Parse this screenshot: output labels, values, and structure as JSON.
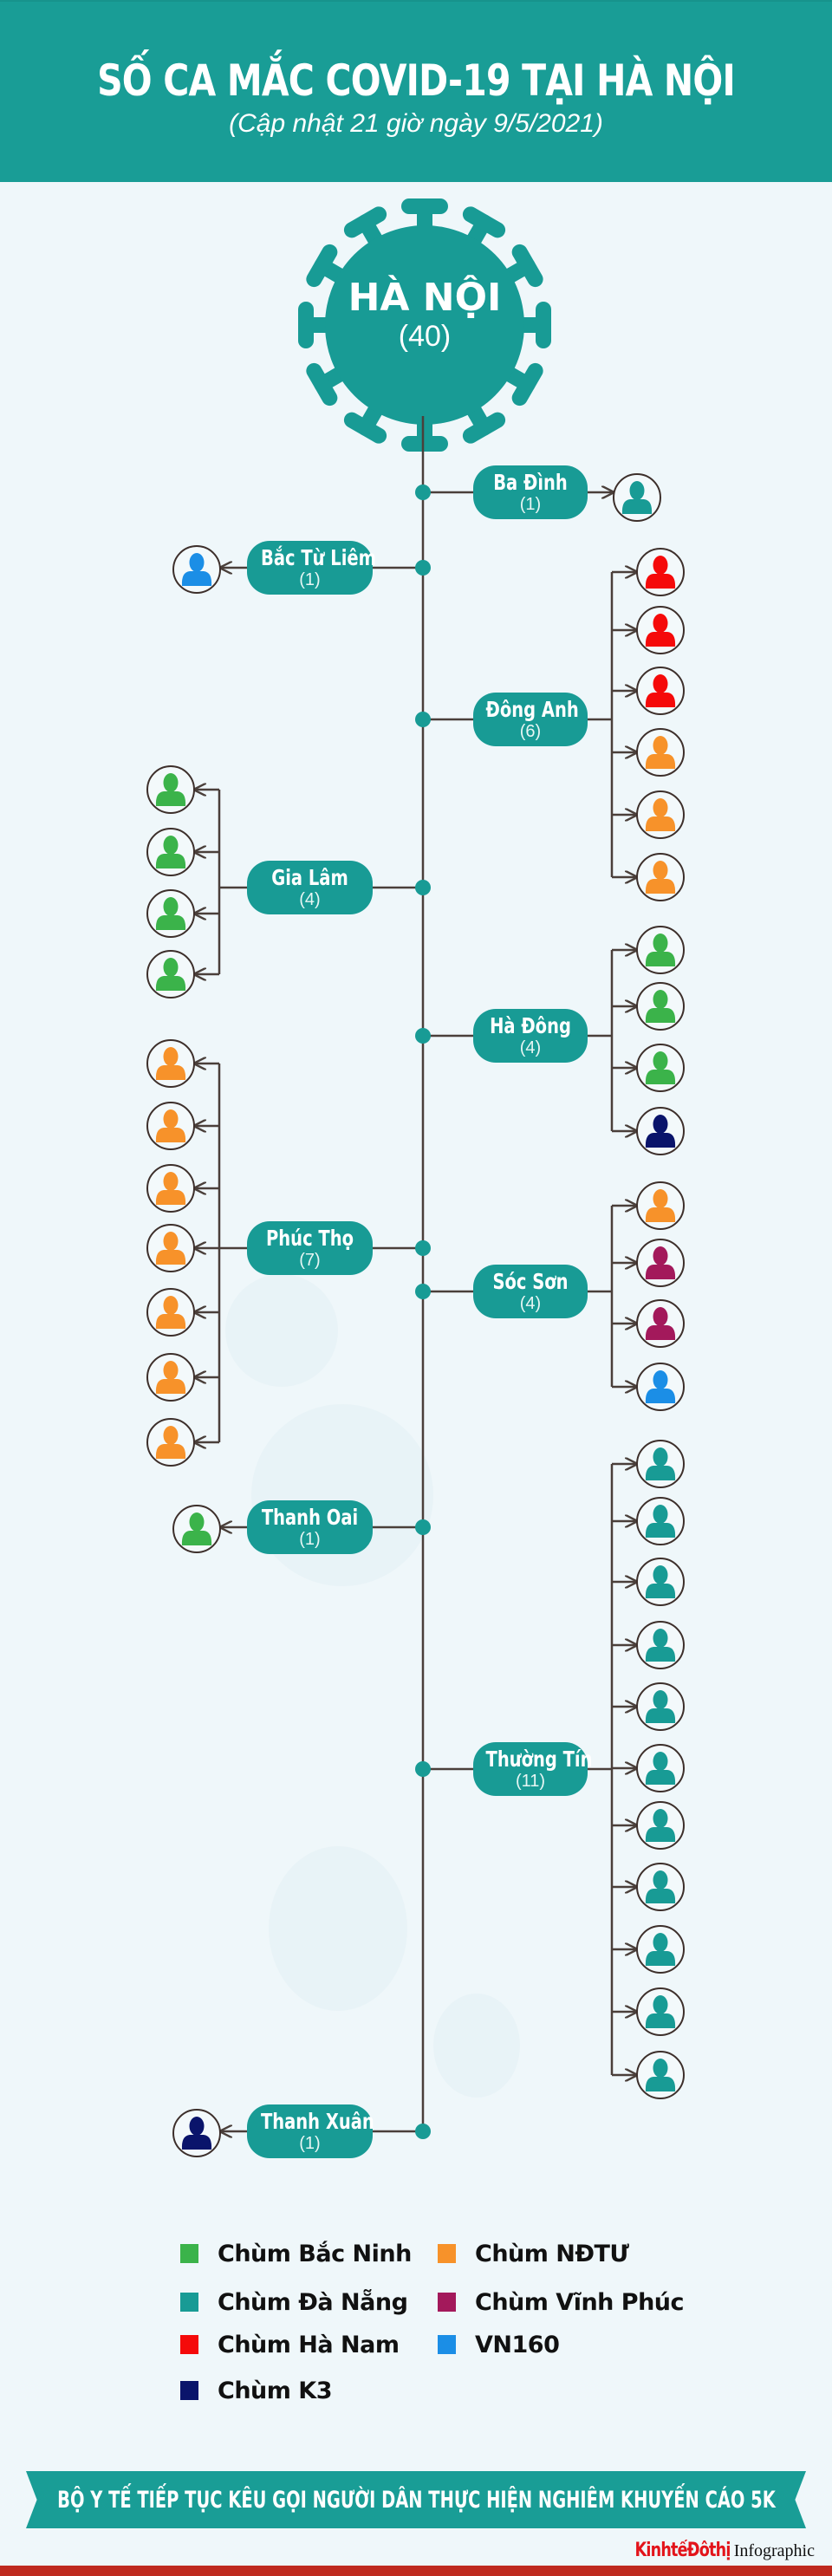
{
  "header": {
    "title": "SỐ CA MẮC COVID-19 TẠI HÀ NỘI",
    "subtitle": "(Cập nhật 21 giờ ngày 9/5/2021)"
  },
  "hub": {
    "name": "HÀ NỘI",
    "count": "(40)",
    "total": 40
  },
  "colors": {
    "teal": "#189b95",
    "line": "#4a3f3a",
    "bac_ninh": "#3bb34a",
    "da_nang": "#189b95",
    "ha_nam": "#f50a0a",
    "k3": "#0a146b",
    "ndtu": "#f7922a",
    "vinh_phuc": "#a3195b",
    "vn160": "#1b8ee6"
  },
  "districts": [
    {
      "name": "Ba Đình",
      "count_label": "(1)",
      "count": 1,
      "side": "right",
      "cases": [
        "da_nang"
      ]
    },
    {
      "name": "Bắc Từ Liêm",
      "count_label": "(1)",
      "count": 1,
      "side": "left",
      "cases": [
        "vn160"
      ]
    },
    {
      "name": "Đông Anh",
      "count_label": "(6)",
      "count": 6,
      "side": "right",
      "cases": [
        "ha_nam",
        "ha_nam",
        "ha_nam",
        "ndtu",
        "ndtu",
        "ndtu"
      ]
    },
    {
      "name": "Gia Lâm",
      "count_label": "(4)",
      "count": 4,
      "side": "left",
      "cases": [
        "bac_ninh",
        "bac_ninh",
        "bac_ninh",
        "bac_ninh"
      ]
    },
    {
      "name": "Hà Đông",
      "count_label": "(4)",
      "count": 4,
      "side": "right",
      "cases": [
        "bac_ninh",
        "bac_ninh",
        "bac_ninh",
        "k3"
      ]
    },
    {
      "name": "Phúc Thọ",
      "count_label": "(7)",
      "count": 7,
      "side": "left",
      "cases": [
        "ndtu",
        "ndtu",
        "ndtu",
        "ndtu",
        "ndtu",
        "ndtu",
        "ndtu"
      ]
    },
    {
      "name": "Sóc Sơn",
      "count_label": "(4)",
      "count": 4,
      "side": "right",
      "cases": [
        "ndtu",
        "vinh_phuc",
        "vinh_phuc",
        "vn160"
      ]
    },
    {
      "name": "Thanh Oai",
      "count_label": "(1)",
      "count": 1,
      "side": "left",
      "cases": [
        "bac_ninh"
      ]
    },
    {
      "name": "Thường Tín",
      "count_label": "(11)",
      "count": 11,
      "side": "right",
      "cases": [
        "da_nang",
        "da_nang",
        "da_nang",
        "da_nang",
        "da_nang",
        "da_nang",
        "da_nang",
        "da_nang",
        "da_nang",
        "da_nang",
        "da_nang"
      ]
    },
    {
      "name": "Thanh Xuân",
      "count_label": "(1)",
      "count": 1,
      "side": "left",
      "cases": [
        "k3"
      ]
    }
  ],
  "legend": [
    {
      "key": "bac_ninh",
      "label": "Chùm Bắc Ninh"
    },
    {
      "key": "ndtu",
      "label": "Chùm NĐTƯ"
    },
    {
      "key": "da_nang",
      "label": "Chùm Đà Nẵng"
    },
    {
      "key": "vinh_phuc",
      "label": "Chùm Vĩnh Phúc"
    },
    {
      "key": "ha_nam",
      "label": "Chùm Hà Nam"
    },
    {
      "key": "vn160",
      "label": "VN160"
    },
    {
      "key": "k3",
      "label": "Chùm K3"
    }
  ],
  "banner": {
    "text": "BỘ Y TẾ TIẾP TỤC KÊU GỌI NGƯỜI DÂN THỰC HIỆN NGHIÊM KHUYẾN CÁO 5K"
  },
  "logo": {
    "brand": "KinhtếĐôthị",
    "tag": "Infographic"
  }
}
